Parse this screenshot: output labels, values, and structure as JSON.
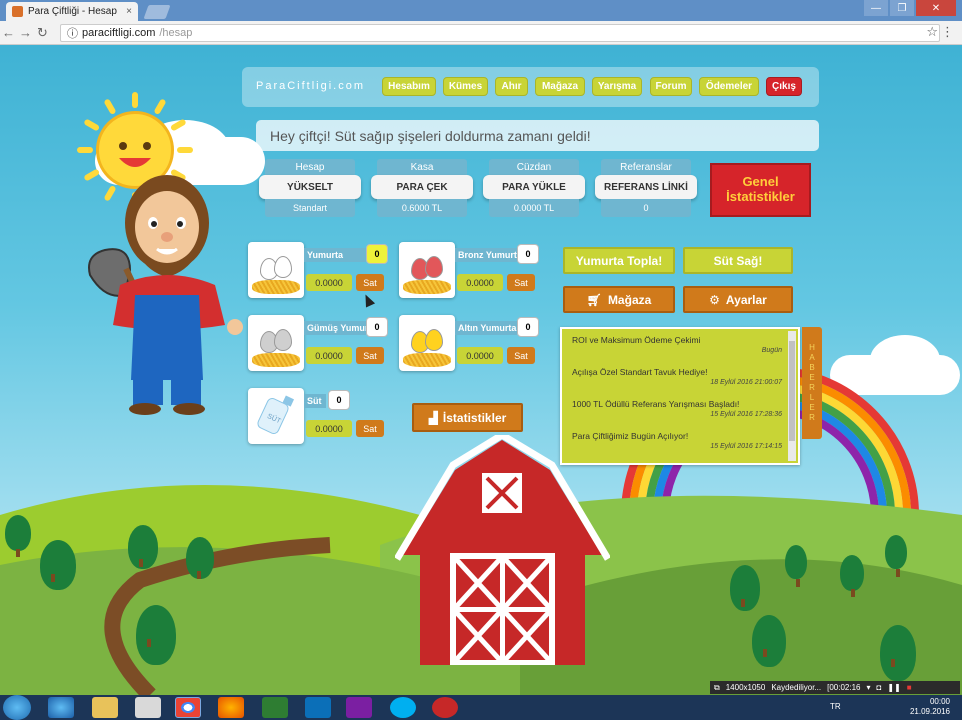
{
  "browser": {
    "tab_title": "Para Çiftliği - Hesap",
    "tab_close": "×",
    "url_host": "paraciftligi.com",
    "url_path": "/hesap",
    "window_controls": [
      "—",
      "❐",
      "✕"
    ]
  },
  "site": {
    "brand": "ParaCiftligi.com",
    "nav": [
      "Hesabım",
      "Kümes",
      "Ahır",
      "Mağaza",
      "Yarışma",
      "Forum",
      "Ödemeler",
      "Çıkış"
    ],
    "message": "Hey çiftçi! Süt sağıp şişeleri doldurma zamanı geldi!"
  },
  "account": [
    {
      "head": "Hesap",
      "button": "YÜKSELT",
      "value": "Standart"
    },
    {
      "head": "Kasa",
      "button": "PARA ÇEK",
      "value": "0.6000 TL"
    },
    {
      "head": "Cüzdan",
      "button": "PARA YÜKLE",
      "value": "0.0000 TL"
    },
    {
      "head": "Referanslar",
      "button": "REFERANS LİNKİ",
      "value": "0"
    }
  ],
  "genel_stats": "Genel İstatistikler",
  "products": [
    {
      "name": "Yumurta",
      "count": "0",
      "amount": "0.0000",
      "sell": "Sat"
    },
    {
      "name": "Bronz Yumurta",
      "count": "0",
      "amount": "0.0000",
      "sell": "Sat"
    },
    {
      "name": "Gümüş Yumurta",
      "count": "0",
      "amount": "0.0000",
      "sell": "Sat"
    },
    {
      "name": "Altın Yumurta",
      "count": "0",
      "amount": "0.0000",
      "sell": "Sat"
    },
    {
      "name": "Süt",
      "count": "0",
      "amount": "0.0000",
      "sell": "Sat"
    }
  ],
  "milk_label": "SÜT",
  "actions": {
    "collect_eggs": "Yumurta Topla!",
    "milk": "Süt Sağ!",
    "store": "Mağaza",
    "settings": "Ayarlar",
    "statistics": "İstatistikler"
  },
  "news_label": [
    "H",
    "A",
    "B",
    "E",
    "R",
    "L",
    "E",
    "R"
  ],
  "news": [
    {
      "title": "ROI ve Maksimum Ödeme Çekimi",
      "date": "Bugün"
    },
    {
      "title": "Açılışa Özel Standart Tavuk Hediye!",
      "date": "18 Eylül 2016 21:00:07"
    },
    {
      "title": "1000 TL Ödüllü Referans Yarışması Başladı!",
      "date": "15 Eylül 2016 17:28:36"
    },
    {
      "title": "Para Çiftliğimiz Bugün Açılıyor!",
      "date": "15 Eylül 2016 17:14:15"
    }
  ],
  "recorder": {
    "resolution": "1400x1050",
    "status": "Kaydediliyor...",
    "time": "[00:02:16"
  },
  "system": {
    "lang": "TR",
    "time": "00:00",
    "date": "21.09.2016"
  },
  "colors": {
    "accent_green": "#c8d436",
    "accent_orange": "#d07a1b",
    "accent_red": "#d6242a",
    "panel_blue": "#6fb6d0"
  }
}
